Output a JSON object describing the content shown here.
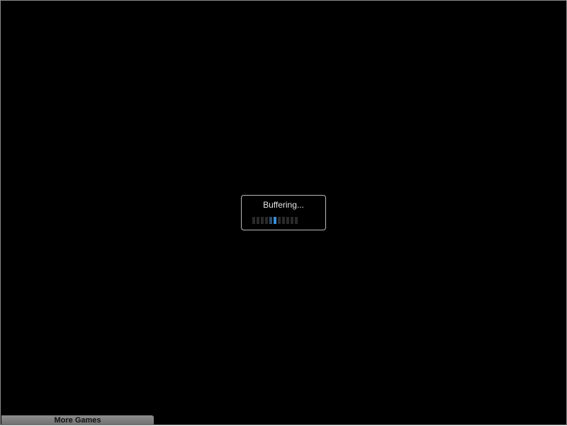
{
  "buffering": {
    "label": "Buffering...",
    "segment_count": 11,
    "active_segments": [
      4,
      5
    ]
  },
  "footer": {
    "more_games_label": "More Games"
  },
  "colors": {
    "background": "#000000",
    "active_segment": "#3a8fd6",
    "inactive_segment": "#2a2a2a",
    "button": "#7f7f7f"
  }
}
